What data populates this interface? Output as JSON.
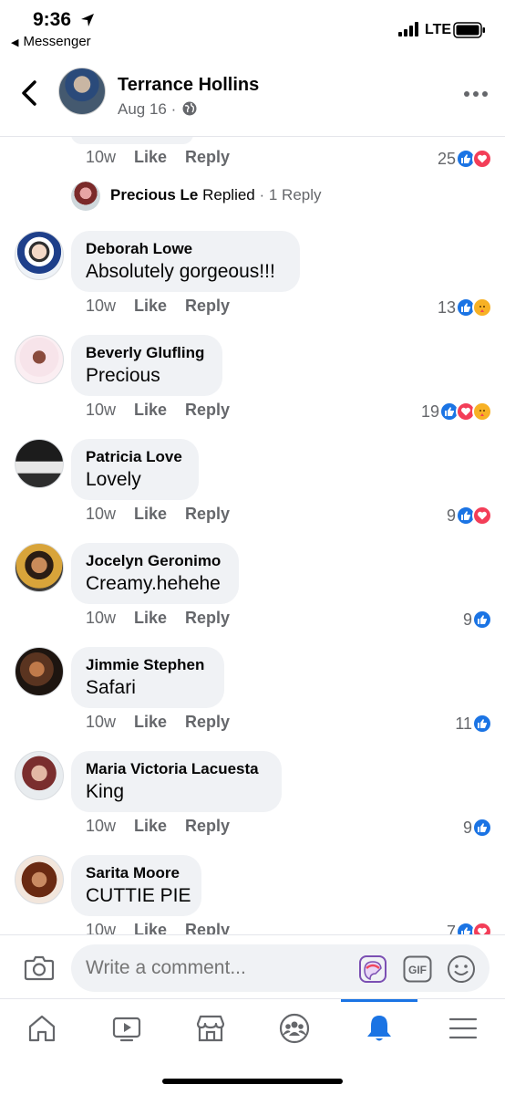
{
  "status_bar": {
    "time": "9:36",
    "back_app": "Messenger",
    "network": "LTE"
  },
  "header": {
    "name": "Terrance Hollins",
    "date": "Aug 16 ·"
  },
  "top_comment": {
    "time": "10w",
    "like": "Like",
    "reply": "Reply",
    "reaction_count": "25",
    "reactions": [
      "like",
      "love"
    ]
  },
  "replied": {
    "name": "Precious Le",
    "label": "Replied",
    "count": "· 1 Reply"
  },
  "comments": [
    {
      "name": "Deborah Lowe",
      "text": "Absolutely gorgeous!!!",
      "time": "10w",
      "like": "Like",
      "reply": "Reply",
      "reaction_count": "13",
      "reactions": [
        "like",
        "care"
      ]
    },
    {
      "name": "Beverly Glufling",
      "text": "Precious",
      "time": "10w",
      "like": "Like",
      "reply": "Reply",
      "reaction_count": "19",
      "reactions": [
        "like",
        "love",
        "care"
      ]
    },
    {
      "name": "Patricia Love",
      "text": "Lovely",
      "time": "10w",
      "like": "Like",
      "reply": "Reply",
      "reaction_count": "9",
      "reactions": [
        "like",
        "love"
      ]
    },
    {
      "name": "Jocelyn Geronimo",
      "text": "Creamy.hehehe",
      "time": "10w",
      "like": "Like",
      "reply": "Reply",
      "reaction_count": "9",
      "reactions": [
        "like"
      ]
    },
    {
      "name": "Jimmie Stephen",
      "text": "Safari",
      "time": "10w",
      "like": "Like",
      "reply": "Reply",
      "reaction_count": "11",
      "reactions": [
        "like"
      ]
    },
    {
      "name": "Maria Victoria Lacuesta",
      "text": "King",
      "time": "10w",
      "like": "Like",
      "reply": "Reply",
      "reaction_count": "9",
      "reactions": [
        "like"
      ]
    },
    {
      "name": "Sarita Moore",
      "text": "CUTTIE PIE",
      "time": "10w",
      "like": "Like",
      "reply": "Reply",
      "reaction_count": "7",
      "reactions": [
        "like",
        "love"
      ]
    }
  ],
  "composer": {
    "placeholder": "Write a comment...",
    "gif_label": "GIF"
  },
  "colors": {
    "accent": "#1b74e4",
    "love": "#f33e58",
    "care": "#f7b125",
    "bubble": "#f0f2f5",
    "secondary_text": "#65676b"
  },
  "nav": [
    "home-icon",
    "watch-icon",
    "marketplace-icon",
    "groups-icon",
    "notifications-icon",
    "menu-icon"
  ]
}
